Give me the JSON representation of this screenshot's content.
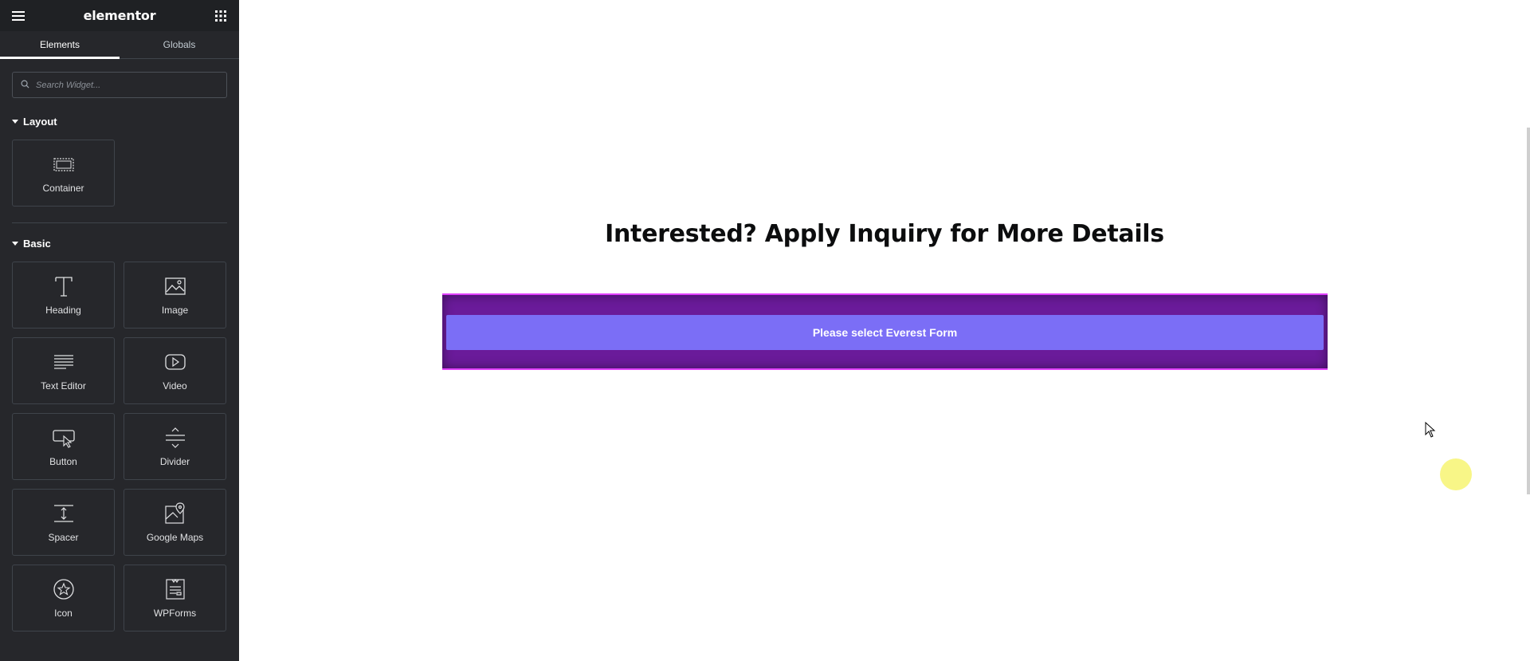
{
  "panel": {
    "brand": "elementor",
    "tabs": [
      {
        "label": "Elements",
        "active": true
      },
      {
        "label": "Globals",
        "active": false
      }
    ],
    "search": {
      "placeholder": "Search Widget..."
    },
    "sections": {
      "layout": {
        "title": "Layout",
        "widgets": [
          {
            "label": "Container",
            "icon": "container-icon"
          }
        ]
      },
      "basic": {
        "title": "Basic",
        "widgets": [
          {
            "label": "Heading",
            "icon": "heading-icon"
          },
          {
            "label": "Image",
            "icon": "image-icon"
          },
          {
            "label": "Text Editor",
            "icon": "text-editor-icon"
          },
          {
            "label": "Video",
            "icon": "video-icon"
          },
          {
            "label": "Button",
            "icon": "button-icon"
          },
          {
            "label": "Divider",
            "icon": "divider-icon"
          },
          {
            "label": "Spacer",
            "icon": "spacer-icon"
          },
          {
            "label": "Google Maps",
            "icon": "google-maps-icon"
          },
          {
            "label": "Icon",
            "icon": "star-icon"
          },
          {
            "label": "WPForms",
            "icon": "wpforms-icon"
          }
        ]
      }
    }
  },
  "canvas": {
    "heading": "Interested? Apply Inquiry for More Details",
    "form_button": "Please select Everest Form"
  },
  "colors": {
    "panel_bg": "#26272b",
    "form_bg": "#6a1b9a",
    "form_border": "#e040fb",
    "form_button_bg": "#7b6ef6"
  }
}
